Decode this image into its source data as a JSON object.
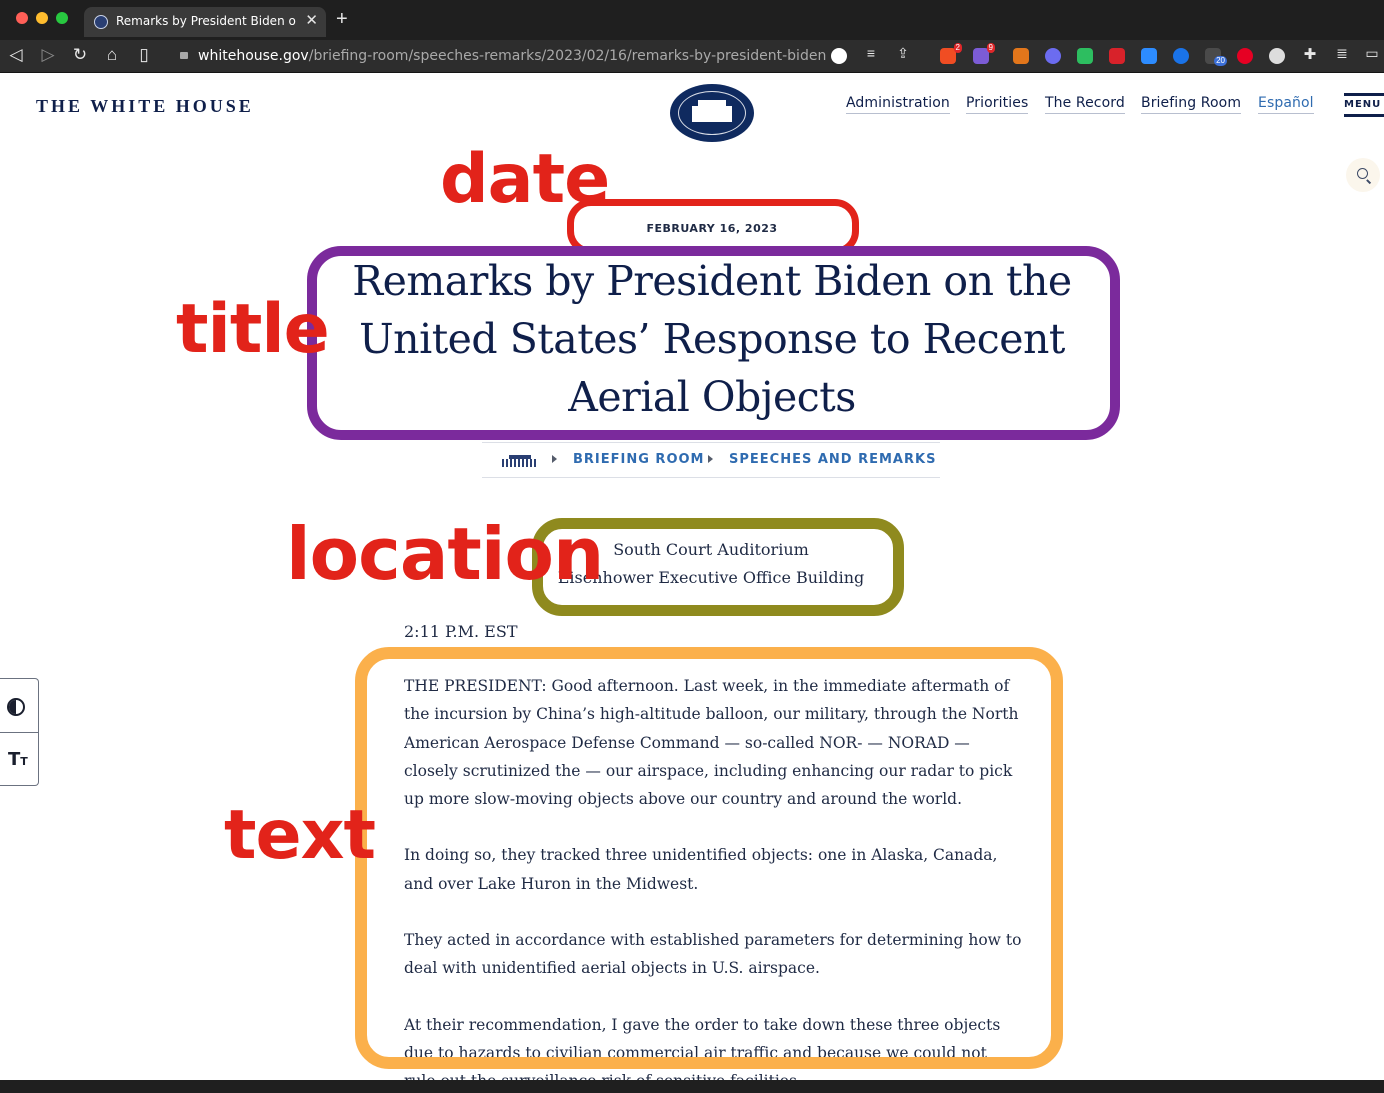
{
  "browser": {
    "tab_title": "Remarks by President Biden on the United States' Response to Recent Aerial Objects",
    "url_host": "whitehouse.gov",
    "url_path": "/briefing-room/speeches-remarks/2023/02/16/remarks-by-president-biden-...",
    "extension_badges": {
      "brave": "2",
      "alert": "9",
      "translate": "20"
    }
  },
  "site": {
    "logo_text": "THE WHITE HOUSE",
    "nav": [
      "Administration",
      "Priorities",
      "The Record",
      "Briefing Room",
      "Español"
    ],
    "menu_label": "MENU"
  },
  "annotations": {
    "date": "date",
    "title": "title",
    "location": "location",
    "text": "text"
  },
  "article": {
    "date": "FEBRUARY 16, 2023",
    "title": "Remarks by President Biden on the United States’ Response to Recent Aerial Objects",
    "breadcrumbs": [
      "BRIEFING ROOM",
      "SPEECHES AND REMARKS"
    ],
    "location_line1": "South Court Auditorium",
    "location_line2": "Eisenhower Executive Office Building",
    "time": "2:11 P.M. EST",
    "paragraphs": [
      "THE PRESIDENT:  Good afternoon.  Last week, in the immediate aftermath of the incursion by China’s high-altitude balloon, our military, through the North American Aerospace Defense Command — so-called NOR- — NORAD — closely scrutinized the — our airspace, including enhancing our radar to pick up more slow-moving objects above our country and around the world.",
      "In doing so, they tracked three unidentified objects: one in Alaska, Canada, and over Lake Huron in the Midwest.",
      "They acted in accordance with established parameters for determining how to deal with unidentified aerial objects in U.S. airspace.",
      "At their recommendation, I gave the order to take down these three objects due to hazards to civilian commercial air traffic and because we could not rule out the surveillance risk of sensitive facilities."
    ]
  },
  "a11y": {
    "text_size_glyph": "T",
    "text_size_small": "T"
  },
  "colors": {
    "navy": "#0f1f4a",
    "link_blue": "#2f6bb0",
    "date_frame": "#e2231a",
    "title_frame": "#7b2a9c",
    "location_frame": "#8f8a1e",
    "text_frame": "#fbb04b"
  }
}
